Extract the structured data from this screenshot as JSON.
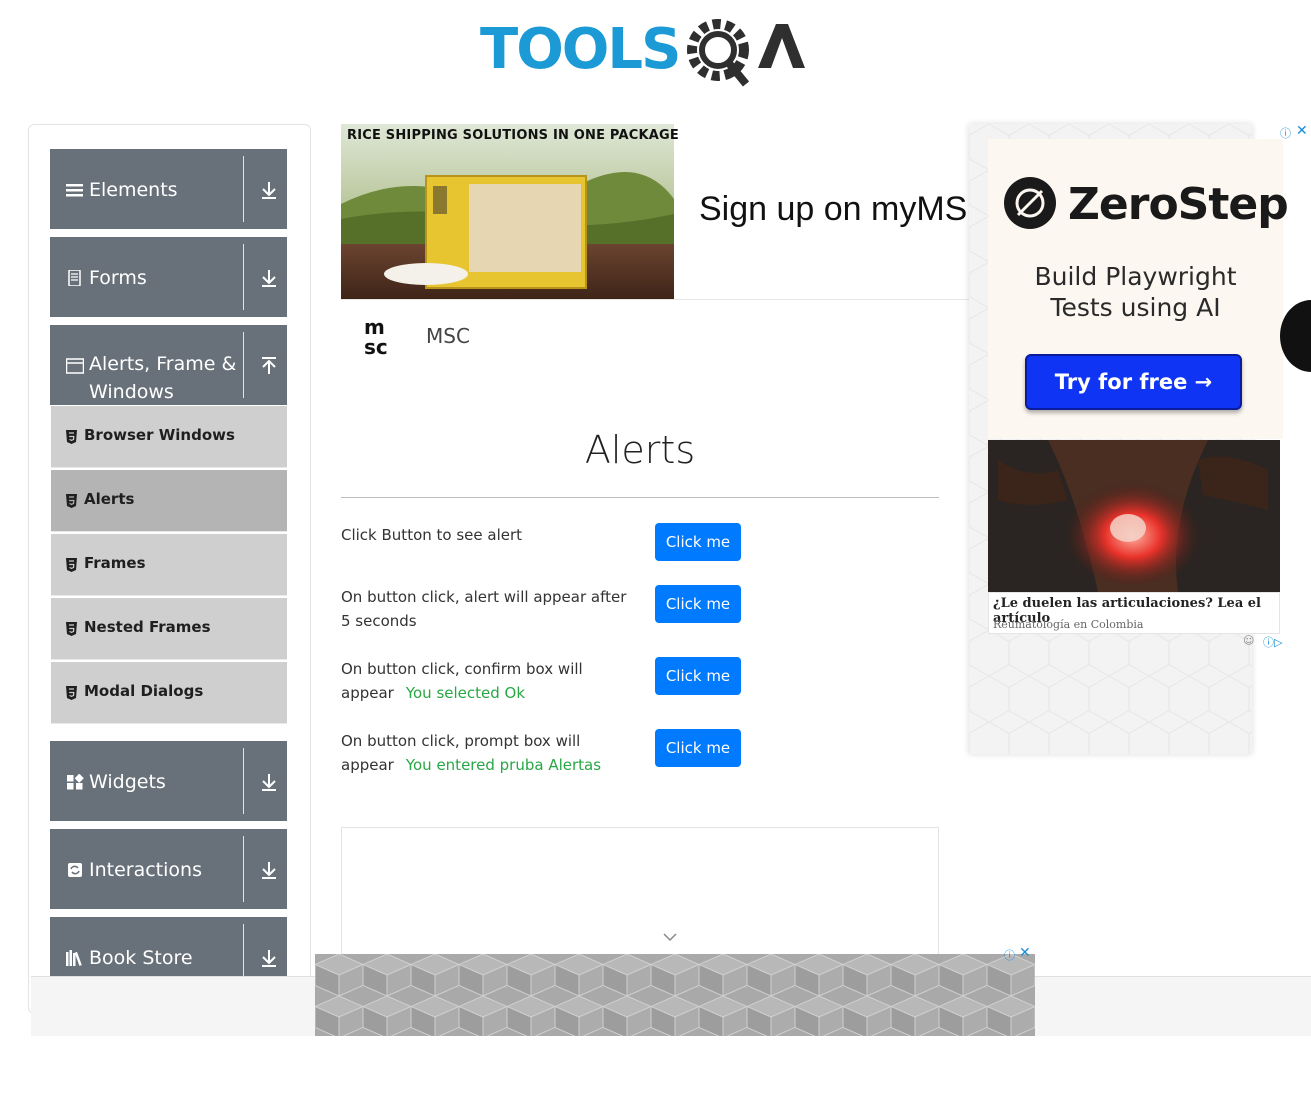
{
  "header": {
    "logo_alt": "TOOLSQA"
  },
  "sidebar": {
    "groups": [
      {
        "label": "Elements",
        "icon": "menu-icon",
        "expanded": false
      },
      {
        "label": "Forms",
        "icon": "form-icon",
        "expanded": false
      },
      {
        "label": "Alerts, Frame & Windows",
        "icon": "window-icon",
        "expanded": true
      },
      {
        "label": "Widgets",
        "icon": "widgets-icon",
        "expanded": false
      },
      {
        "label": "Interactions",
        "icon": "interactions-icon",
        "expanded": false
      },
      {
        "label": "Book Store",
        "icon": "bookstore-icon",
        "expanded": false
      }
    ],
    "subitems": [
      {
        "label": "Browser Windows",
        "active": false
      },
      {
        "label": "Alerts",
        "active": true
      },
      {
        "label": "Frames",
        "active": false
      },
      {
        "label": "Nested Frames",
        "active": false
      },
      {
        "label": "Modal Dialogs",
        "active": false
      }
    ]
  },
  "ad_top": {
    "caption": "RICE SHIPPING SOLUTIONS IN ONE PACKAGE",
    "headline": "Sign up on myMSC",
    "advertiser": "MSC"
  },
  "main": {
    "title": "Alerts",
    "rows": [
      {
        "text": "Click Button to see alert",
        "button": "Click me",
        "result": ""
      },
      {
        "text": "On button click, alert will appear after 5 seconds",
        "button": "Click me",
        "result": ""
      },
      {
        "text": "On button click, confirm box will appear",
        "button": "Click me",
        "result": "You selected Ok"
      },
      {
        "text": "On button click, prompt box will appear",
        "button": "Click me",
        "result": "You entered pruba Alertas"
      }
    ]
  },
  "ad_right": {
    "brand": "ZeroStep",
    "tagline_1": "Build Playwright",
    "tagline_2": "Tests using AI",
    "cta": "Try for free →",
    "article_title": "¿Le duelen las articulaciones? Lea el artículo",
    "article_source": "Reumatología en Colombia"
  },
  "colors": {
    "sidebar_group": "#687179",
    "sidebar_sub": "#cfcfcf",
    "sidebar_sub_active": "#b4b4b4",
    "primary_button": "#007bff",
    "success_text": "#28a745",
    "logo_blue": "#1b9ad6",
    "cta_blue": "#1034f4"
  }
}
